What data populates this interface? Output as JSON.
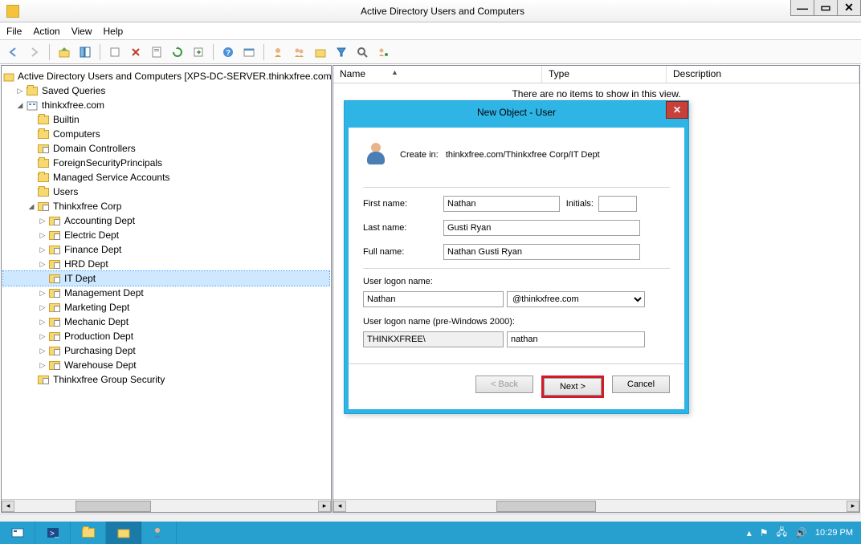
{
  "window": {
    "title": "Active Directory Users and Computers"
  },
  "menu": {
    "file": "File",
    "action": "Action",
    "view": "View",
    "help": "Help"
  },
  "tree": {
    "root": "Active Directory Users and Computers [XPS-DC-SERVER.thinkxfree.com]",
    "saved_queries": "Saved Queries",
    "domain": "thinkxfree.com",
    "builtin": "Builtin",
    "computers": "Computers",
    "dc": "Domain Controllers",
    "fsp": "ForeignSecurityPrincipals",
    "msa": "Managed Service Accounts",
    "users": "Users",
    "corp": "Thinkxfree Corp",
    "accounting": "Accounting Dept",
    "electric": "Electric Dept",
    "finance": "Finance Dept",
    "hrd": "HRD Dept",
    "it": "IT Dept",
    "management": "Management Dept",
    "marketing": "Marketing Dept",
    "mechanic": "Mechanic Dept",
    "production": "Production Dept",
    "purchasing": "Purchasing Dept",
    "warehouse": "Warehouse Dept",
    "group_sec": "Thinkxfree Group Security"
  },
  "listview": {
    "col_name": "Name",
    "col_type": "Type",
    "col_desc": "Description",
    "empty": "There are no items to show in this view."
  },
  "dialog": {
    "title": "New Object - User",
    "create_in_label": "Create in:",
    "create_in_path": "thinkxfree.com/Thinkxfree Corp/IT Dept",
    "first_name_label": "First name:",
    "first_name": "Nathan",
    "initials_label": "Initials:",
    "initials": "",
    "last_name_label": "Last name:",
    "last_name": "Gusti Ryan",
    "full_name_label": "Full name:",
    "full_name": "Nathan Gusti Ryan",
    "logon_label": "User logon name:",
    "logon": "Nathan",
    "domain_suffix": "@thinkxfree.com",
    "logon2000_label": "User logon name (pre-Windows 2000):",
    "netbios": "THINKXFREE\\",
    "logon2000": "nathan",
    "back": "< Back",
    "next": "Next >",
    "cancel": "Cancel"
  },
  "taskbar": {
    "time": "10:29 PM"
  }
}
